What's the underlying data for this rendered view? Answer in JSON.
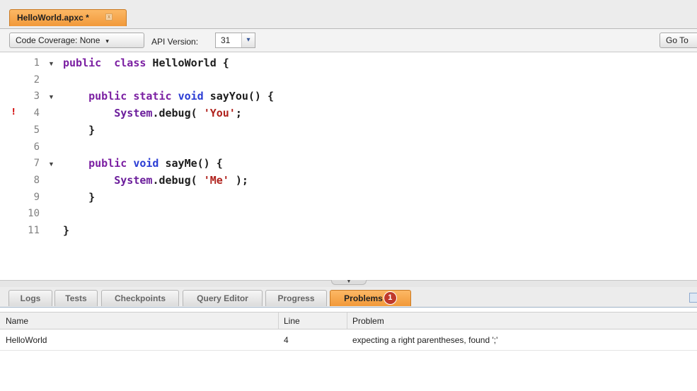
{
  "file_tab": {
    "label": "HelloWorld.apxc *",
    "close_glyph": "x"
  },
  "toolbar": {
    "coverage_label": "Code Coverage: None",
    "coverage_caret": "▾",
    "api_label": "API Version:",
    "api_value": "31",
    "api_arrow": "▾",
    "goto_label": "Go To"
  },
  "editor": {
    "error_marker": "!",
    "fold_glyph": "▼",
    "lines": [
      {
        "num": "1",
        "fold": true,
        "error": false,
        "tokens": [
          [
            "kw",
            "public"
          ],
          [
            "",
            "  "
          ],
          [
            "kw",
            "class"
          ],
          [
            "",
            " HelloWorld {"
          ]
        ]
      },
      {
        "num": "2",
        "fold": false,
        "error": false,
        "tokens": []
      },
      {
        "num": "3",
        "fold": true,
        "error": false,
        "tokens": [
          [
            "",
            "    "
          ],
          [
            "kw",
            "public"
          ],
          [
            "",
            " "
          ],
          [
            "kw",
            "static"
          ],
          [
            "",
            " "
          ],
          [
            "ty",
            "void"
          ],
          [
            "",
            " sayYou() {"
          ]
        ]
      },
      {
        "num": "4",
        "fold": false,
        "error": true,
        "tokens": [
          [
            "",
            "        "
          ],
          [
            "cls",
            "System"
          ],
          [
            "",
            ".debug( "
          ],
          [
            "str",
            "'You'"
          ],
          [
            "",
            ";"
          ]
        ]
      },
      {
        "num": "5",
        "fold": false,
        "error": false,
        "tokens": [
          [
            "",
            "    }"
          ]
        ]
      },
      {
        "num": "6",
        "fold": false,
        "error": false,
        "tokens": []
      },
      {
        "num": "7",
        "fold": true,
        "error": false,
        "tokens": [
          [
            "",
            "    "
          ],
          [
            "kw",
            "public"
          ],
          [
            "",
            " "
          ],
          [
            "ty",
            "void"
          ],
          [
            "",
            " sayMe() {"
          ]
        ]
      },
      {
        "num": "8",
        "fold": false,
        "error": false,
        "tokens": [
          [
            "",
            "        "
          ],
          [
            "cls",
            "System"
          ],
          [
            "",
            ".debug( "
          ],
          [
            "str",
            "'Me'"
          ],
          [
            "",
            " );"
          ]
        ]
      },
      {
        "num": "9",
        "fold": false,
        "error": false,
        "tokens": [
          [
            "",
            "    }"
          ]
        ]
      },
      {
        "num": "10",
        "fold": false,
        "error": false,
        "tokens": []
      },
      {
        "num": "11",
        "fold": false,
        "error": false,
        "tokens": [
          [
            "",
            "}"
          ]
        ]
      }
    ]
  },
  "splitter": {
    "grip_glyph": "▼"
  },
  "bottom_tabs": [
    {
      "label": "Logs",
      "active": false
    },
    {
      "label": "Tests",
      "active": false
    },
    {
      "label": "Checkpoints",
      "active": false
    },
    {
      "label": "Query Editor",
      "active": false
    },
    {
      "label": "Progress",
      "active": false
    },
    {
      "label": "Problems",
      "active": true,
      "badge": "1"
    }
  ],
  "problems": {
    "columns": [
      "Name",
      "Line",
      "Problem"
    ],
    "rows": [
      {
        "name": "HelloWorld",
        "line": "4",
        "problem": "expecting a right parentheses, found ';'"
      }
    ]
  },
  "colors": {
    "accent_tab": "#f1993a",
    "keyword": "#7b1fa2",
    "type": "#2a3cd4",
    "string": "#b0221d",
    "error": "#d10000",
    "badge": "#c0392b"
  }
}
